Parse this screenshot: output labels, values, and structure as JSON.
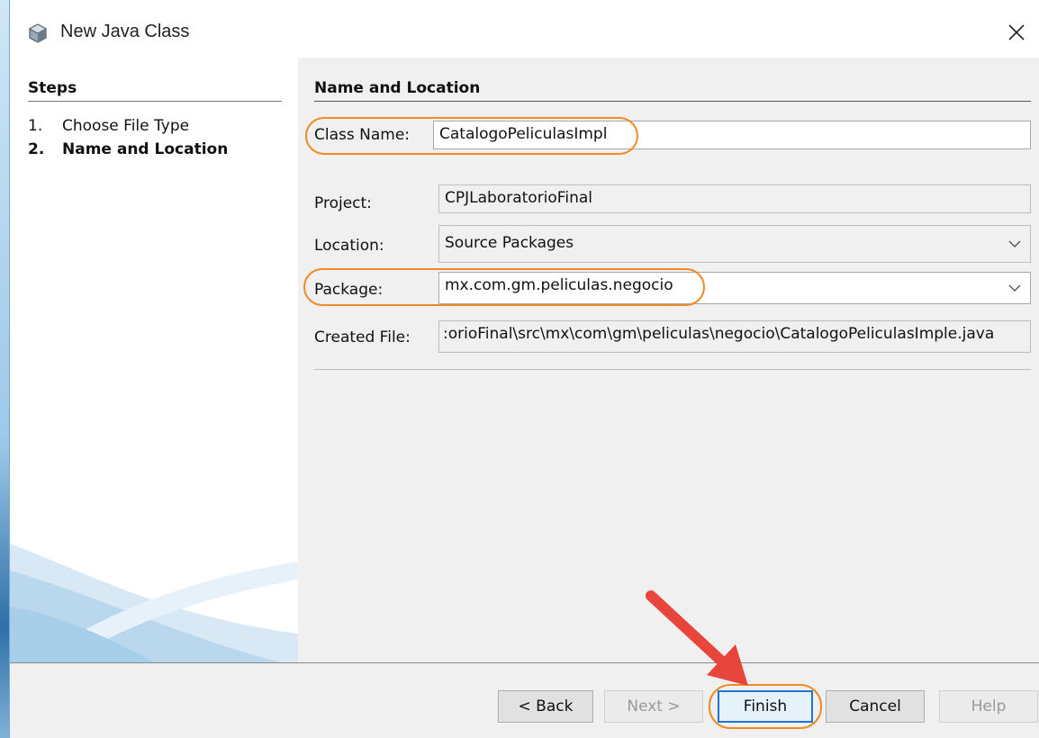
{
  "window": {
    "title": "New Java Class",
    "app_icon": "java-class-cube-icon",
    "close_icon": "close-icon"
  },
  "steps": {
    "heading": "Steps",
    "items": [
      {
        "number": "1.",
        "label": "Choose File Type",
        "current": false
      },
      {
        "number": "2.",
        "label": "Name and Location",
        "current": true
      }
    ]
  },
  "form": {
    "heading": "Name and Location",
    "class_name": {
      "label": "Class Name:",
      "value": "CatalogoPeliculasImpl"
    },
    "project": {
      "label": "Project:",
      "value": "CPJLaboratorioFinal"
    },
    "location": {
      "label": "Location:",
      "value": "Source Packages"
    },
    "package": {
      "label": "Package:",
      "value": "mx.com.gm.peliculas.negocio"
    },
    "created_file": {
      "label": "Created File:",
      "value": ":orioFinal\\src\\mx\\com\\gm\\peliculas\\negocio\\CatalogoPeliculasImple.java"
    }
  },
  "buttons": {
    "back": "< Back",
    "next": "Next >",
    "finish": "Finish",
    "cancel": "Cancel",
    "help": "Help"
  },
  "colors": {
    "highlight": "#f08a24",
    "arrow": "#e8453c",
    "default_button_border": "#1e74d6"
  }
}
